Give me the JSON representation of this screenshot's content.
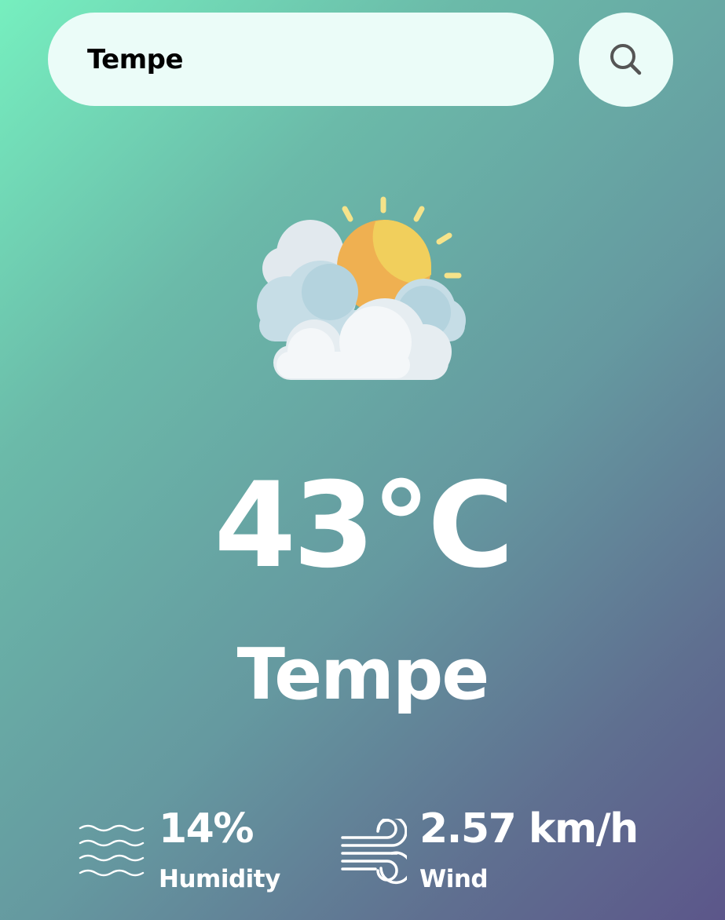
{
  "search": {
    "value": "Tempe",
    "icon": "search-icon"
  },
  "weather": {
    "icon": "partly-cloudy-icon",
    "temperature": "43°C",
    "city": "Tempe"
  },
  "details": {
    "humidity": {
      "value": "14%",
      "label": "Humidity",
      "icon": "humidity-icon"
    },
    "wind": {
      "value": "2.57 km/h",
      "label": "Wind",
      "icon": "wind-icon"
    }
  },
  "colors": {
    "gradient_start": "#76efbf",
    "gradient_end": "#5c568a",
    "search_bg": "#ebfcf8",
    "text": "#ffffff"
  }
}
